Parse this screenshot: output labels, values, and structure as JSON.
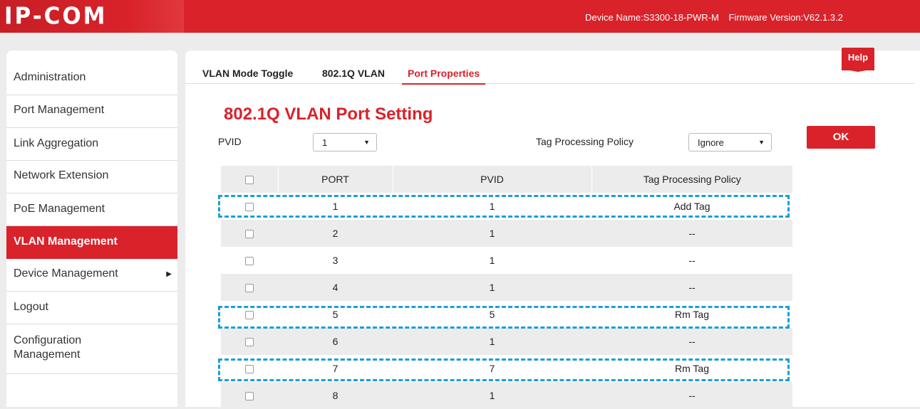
{
  "header": {
    "logo": "IP-COM",
    "device_name": "Device Name:S3300-18-PWR-M",
    "firmware_version": "Firmware Version:V62.1.3.2"
  },
  "sidebar": {
    "items": [
      {
        "label": "Administration"
      },
      {
        "label": "Port Management"
      },
      {
        "label": "Link Aggregation"
      },
      {
        "label": "Network Extension"
      },
      {
        "label": "PoE Management"
      },
      {
        "label": "VLAN Management",
        "active": true
      },
      {
        "label": "Device Management",
        "has_submenu": true
      },
      {
        "label": "Logout"
      },
      {
        "label": "Configuration Management"
      }
    ]
  },
  "tabs": [
    {
      "label": "VLAN Mode Toggle"
    },
    {
      "label": "802.1Q VLAN"
    },
    {
      "label": "Port Properties",
      "active": true
    }
  ],
  "help_label": "Help",
  "page_title": "802.1Q VLAN Port Setting",
  "form": {
    "pvid_label": "PVID",
    "pvid_value": "1",
    "tag_policy_label": "Tag Processing Policy",
    "tag_policy_value": "Ignore",
    "ok_label": "OK"
  },
  "table": {
    "headers": [
      "PORT",
      "PVID",
      "Tag Processing Policy"
    ],
    "rows": [
      {
        "port": "1",
        "pvid": "1",
        "policy": "Add Tag"
      },
      {
        "port": "2",
        "pvid": "1",
        "policy": "--"
      },
      {
        "port": "3",
        "pvid": "1",
        "policy": "--"
      },
      {
        "port": "4",
        "pvid": "1",
        "policy": "--"
      },
      {
        "port": "5",
        "pvid": "5",
        "policy": "Rm Tag"
      },
      {
        "port": "6",
        "pvid": "1",
        "policy": "--"
      },
      {
        "port": "7",
        "pvid": "7",
        "policy": "Rm Tag"
      },
      {
        "port": "8",
        "pvid": "1",
        "policy": "--"
      }
    ]
  },
  "colors": {
    "brand_red": "#d9222a",
    "highlight_blue": "#1a9fd6"
  }
}
